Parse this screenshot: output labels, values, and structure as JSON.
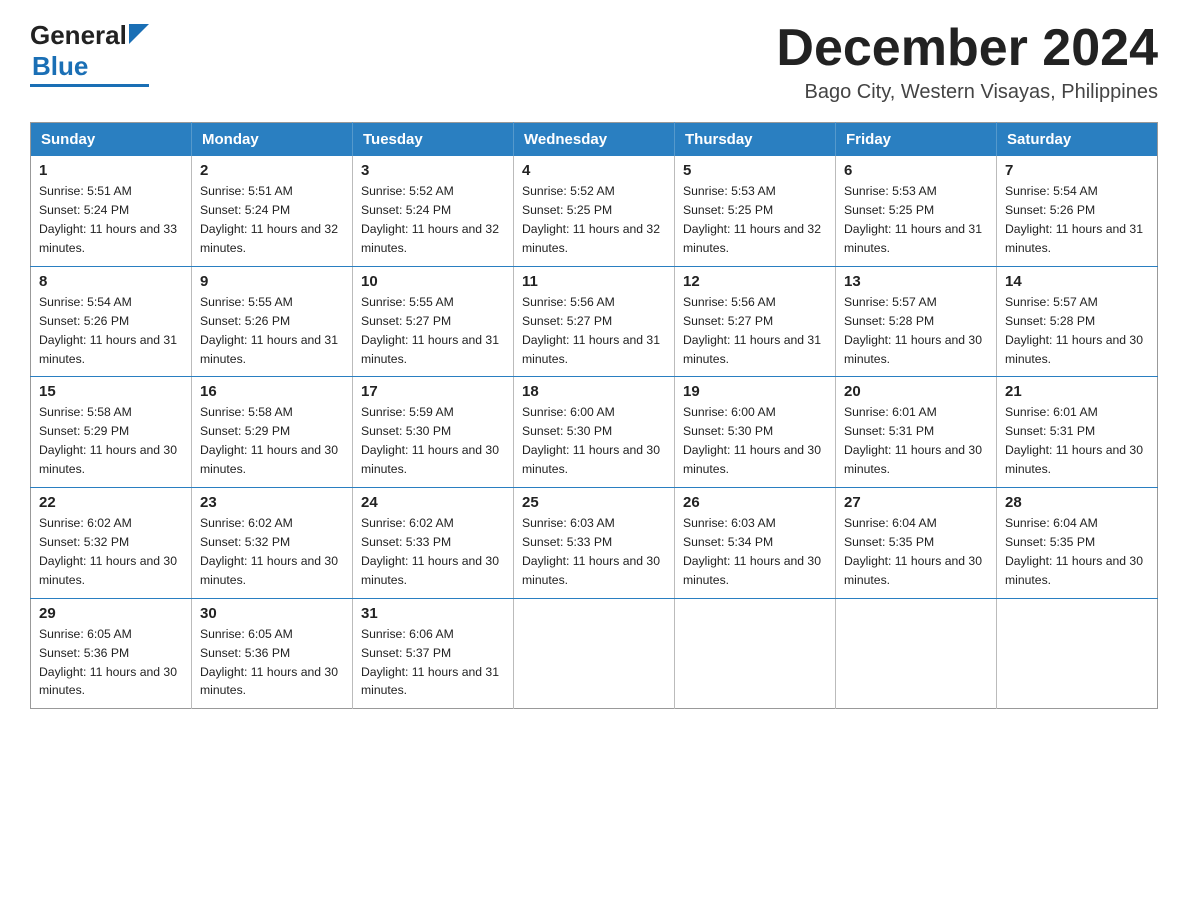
{
  "header": {
    "logo_general": "General",
    "logo_blue": "Blue",
    "month_year": "December 2024",
    "location": "Bago City, Western Visayas, Philippines"
  },
  "weekdays": [
    "Sunday",
    "Monday",
    "Tuesday",
    "Wednesday",
    "Thursday",
    "Friday",
    "Saturday"
  ],
  "weeks": [
    [
      {
        "day": "1",
        "sunrise": "5:51 AM",
        "sunset": "5:24 PM",
        "daylight": "11 hours and 33 minutes."
      },
      {
        "day": "2",
        "sunrise": "5:51 AM",
        "sunset": "5:24 PM",
        "daylight": "11 hours and 32 minutes."
      },
      {
        "day": "3",
        "sunrise": "5:52 AM",
        "sunset": "5:24 PM",
        "daylight": "11 hours and 32 minutes."
      },
      {
        "day": "4",
        "sunrise": "5:52 AM",
        "sunset": "5:25 PM",
        "daylight": "11 hours and 32 minutes."
      },
      {
        "day": "5",
        "sunrise": "5:53 AM",
        "sunset": "5:25 PM",
        "daylight": "11 hours and 32 minutes."
      },
      {
        "day": "6",
        "sunrise": "5:53 AM",
        "sunset": "5:25 PM",
        "daylight": "11 hours and 31 minutes."
      },
      {
        "day": "7",
        "sunrise": "5:54 AM",
        "sunset": "5:26 PM",
        "daylight": "11 hours and 31 minutes."
      }
    ],
    [
      {
        "day": "8",
        "sunrise": "5:54 AM",
        "sunset": "5:26 PM",
        "daylight": "11 hours and 31 minutes."
      },
      {
        "day": "9",
        "sunrise": "5:55 AM",
        "sunset": "5:26 PM",
        "daylight": "11 hours and 31 minutes."
      },
      {
        "day": "10",
        "sunrise": "5:55 AM",
        "sunset": "5:27 PM",
        "daylight": "11 hours and 31 minutes."
      },
      {
        "day": "11",
        "sunrise": "5:56 AM",
        "sunset": "5:27 PM",
        "daylight": "11 hours and 31 minutes."
      },
      {
        "day": "12",
        "sunrise": "5:56 AM",
        "sunset": "5:27 PM",
        "daylight": "11 hours and 31 minutes."
      },
      {
        "day": "13",
        "sunrise": "5:57 AM",
        "sunset": "5:28 PM",
        "daylight": "11 hours and 30 minutes."
      },
      {
        "day": "14",
        "sunrise": "5:57 AM",
        "sunset": "5:28 PM",
        "daylight": "11 hours and 30 minutes."
      }
    ],
    [
      {
        "day": "15",
        "sunrise": "5:58 AM",
        "sunset": "5:29 PM",
        "daylight": "11 hours and 30 minutes."
      },
      {
        "day": "16",
        "sunrise": "5:58 AM",
        "sunset": "5:29 PM",
        "daylight": "11 hours and 30 minutes."
      },
      {
        "day": "17",
        "sunrise": "5:59 AM",
        "sunset": "5:30 PM",
        "daylight": "11 hours and 30 minutes."
      },
      {
        "day": "18",
        "sunrise": "6:00 AM",
        "sunset": "5:30 PM",
        "daylight": "11 hours and 30 minutes."
      },
      {
        "day": "19",
        "sunrise": "6:00 AM",
        "sunset": "5:30 PM",
        "daylight": "11 hours and 30 minutes."
      },
      {
        "day": "20",
        "sunrise": "6:01 AM",
        "sunset": "5:31 PM",
        "daylight": "11 hours and 30 minutes."
      },
      {
        "day": "21",
        "sunrise": "6:01 AM",
        "sunset": "5:31 PM",
        "daylight": "11 hours and 30 minutes."
      }
    ],
    [
      {
        "day": "22",
        "sunrise": "6:02 AM",
        "sunset": "5:32 PM",
        "daylight": "11 hours and 30 minutes."
      },
      {
        "day": "23",
        "sunrise": "6:02 AM",
        "sunset": "5:32 PM",
        "daylight": "11 hours and 30 minutes."
      },
      {
        "day": "24",
        "sunrise": "6:02 AM",
        "sunset": "5:33 PM",
        "daylight": "11 hours and 30 minutes."
      },
      {
        "day": "25",
        "sunrise": "6:03 AM",
        "sunset": "5:33 PM",
        "daylight": "11 hours and 30 minutes."
      },
      {
        "day": "26",
        "sunrise": "6:03 AM",
        "sunset": "5:34 PM",
        "daylight": "11 hours and 30 minutes."
      },
      {
        "day": "27",
        "sunrise": "6:04 AM",
        "sunset": "5:35 PM",
        "daylight": "11 hours and 30 minutes."
      },
      {
        "day": "28",
        "sunrise": "6:04 AM",
        "sunset": "5:35 PM",
        "daylight": "11 hours and 30 minutes."
      }
    ],
    [
      {
        "day": "29",
        "sunrise": "6:05 AM",
        "sunset": "5:36 PM",
        "daylight": "11 hours and 30 minutes."
      },
      {
        "day": "30",
        "sunrise": "6:05 AM",
        "sunset": "5:36 PM",
        "daylight": "11 hours and 30 minutes."
      },
      {
        "day": "31",
        "sunrise": "6:06 AM",
        "sunset": "5:37 PM",
        "daylight": "11 hours and 31 minutes."
      },
      null,
      null,
      null,
      null
    ]
  ]
}
